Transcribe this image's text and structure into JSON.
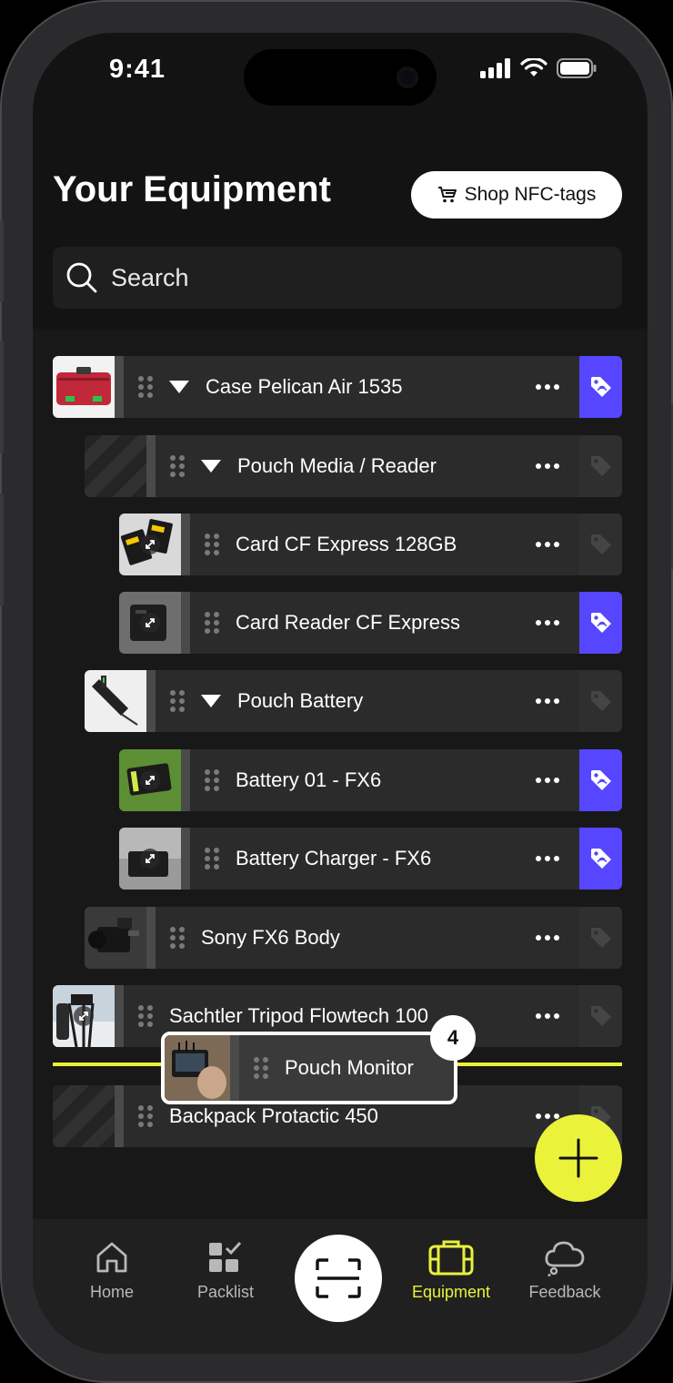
{
  "status": {
    "time": "9:41"
  },
  "header": {
    "title": "Your Equipment",
    "shop_label": "Shop NFC-tags"
  },
  "search": {
    "placeholder": "Search"
  },
  "items": [
    {
      "label": "Case Pelican Air 1535",
      "expanded": true,
      "tagged": true,
      "thumb": "red-case"
    },
    {
      "label": "Pouch Media / Reader",
      "expanded": true,
      "tagged": false,
      "thumb": "striped"
    },
    {
      "label": "Card CF Express 128GB",
      "tagged": false,
      "thumb": "cards"
    },
    {
      "label": "Card Reader CF Express",
      "tagged": true,
      "thumb": "reader"
    },
    {
      "label": "Pouch Battery",
      "expanded": true,
      "tagged": false,
      "thumb": "pouch"
    },
    {
      "label": "Battery 01 - FX6",
      "tagged": true,
      "thumb": "battery"
    },
    {
      "label": "Battery Charger - FX6",
      "tagged": true,
      "thumb": "charger"
    },
    {
      "label": "Sony FX6 Body",
      "tagged": false,
      "thumb": "camera"
    },
    {
      "label": "Sachtler Tripod Flowtech 100",
      "tagged": false,
      "thumb": "tripod"
    },
    {
      "label": "Backpack Protactic 450",
      "tagged": false,
      "thumb": "striped"
    }
  ],
  "drag": {
    "label": "Pouch Monitor",
    "count": "4"
  },
  "tabs": [
    {
      "label": "Home",
      "icon": "home-icon"
    },
    {
      "label": "Packlist",
      "icon": "packlist-icon"
    },
    {
      "label": "Equipment",
      "icon": "briefcase-icon",
      "active": true
    },
    {
      "label": "Feedback",
      "icon": "cloud-icon"
    }
  ],
  "colors": {
    "accent": "#e9f23a",
    "tag_active": "#5746ff",
    "background": "#131313"
  }
}
